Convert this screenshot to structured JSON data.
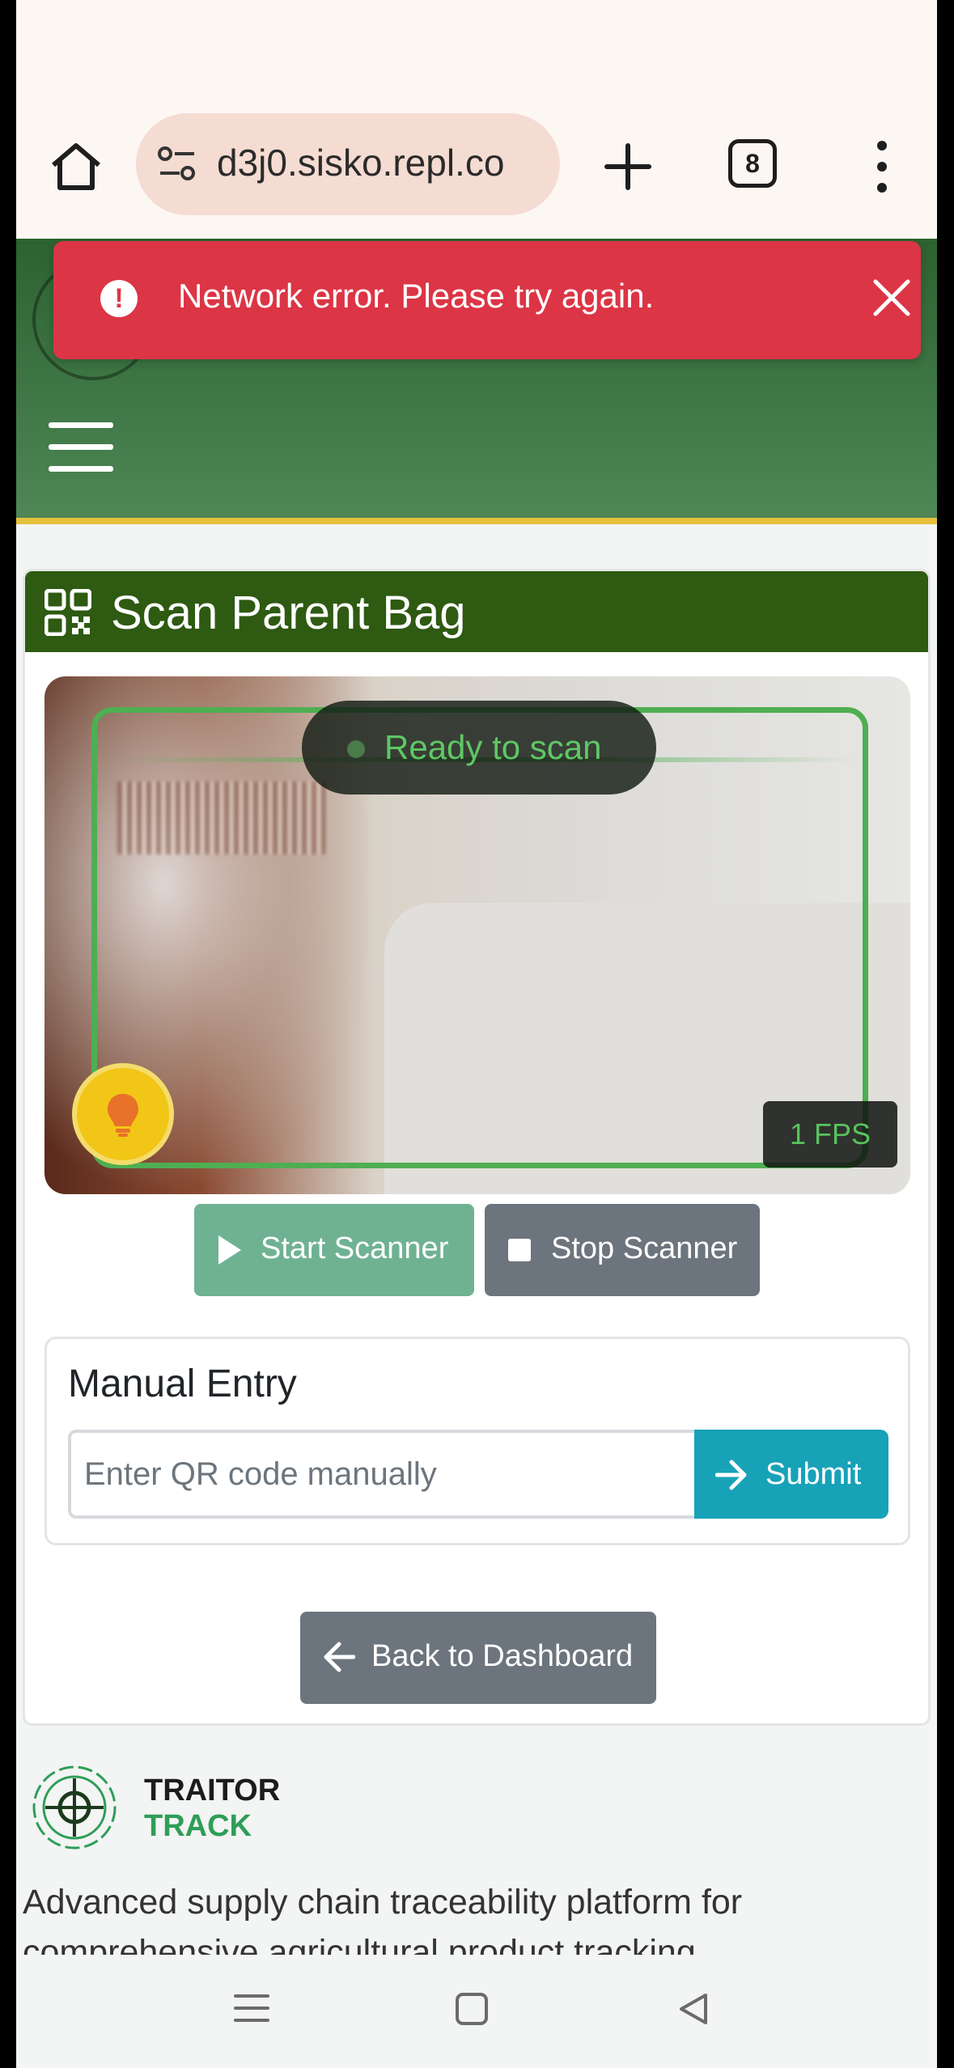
{
  "browser": {
    "url": "d3j0.sisko.repl.co",
    "tab_count": "8"
  },
  "toast": {
    "message": "Network error. Please try again.",
    "color": "#dc3545"
  },
  "page": {
    "card_title": "Scan Parent Bag",
    "scanner_status": "Ready to scan",
    "fps": "1  FPS",
    "start_label": "Start Scanner",
    "stop_label": "Stop Scanner",
    "manual_title": "Manual Entry",
    "manual_placeholder": "Enter QR code manually",
    "submit_label": "Submit",
    "back_label": "Back to Dashboard"
  },
  "footer": {
    "brand_line1": "TRAITOR",
    "brand_line2": "TRACK",
    "description": "Advanced supply chain traceability platform for comprehensive agricultural product tracking"
  },
  "colors": {
    "header_green": "#2e5a12",
    "accent_green": "#4fae52",
    "submit_teal": "#17a2b8",
    "secondary_gray": "#6c757d"
  }
}
